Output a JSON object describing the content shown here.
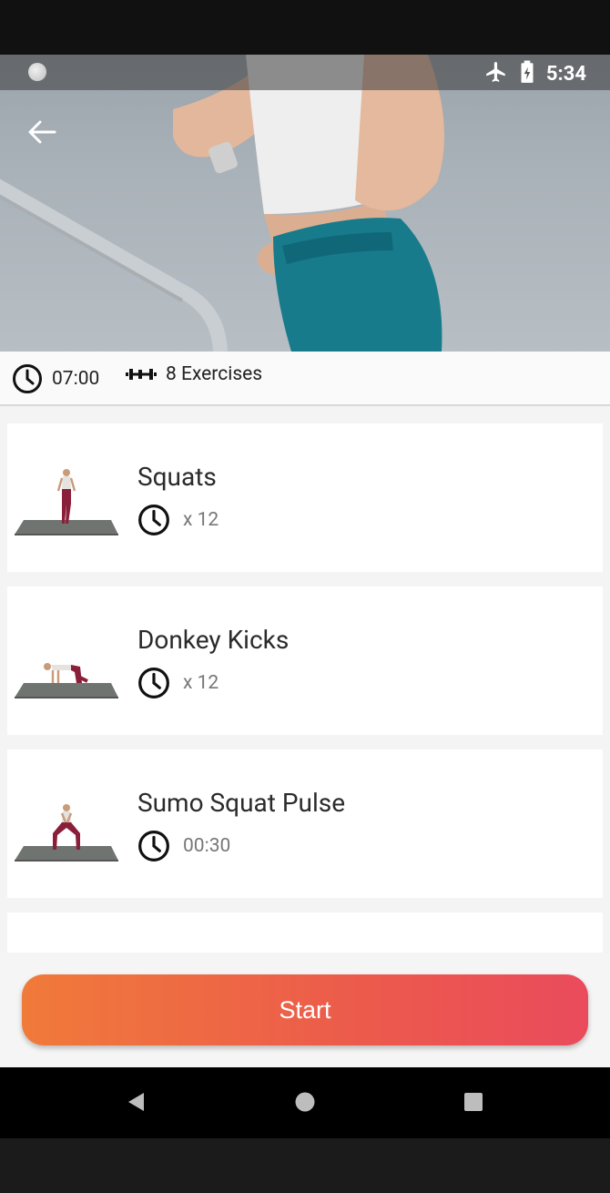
{
  "status_bar": {
    "time": "5:34",
    "icons": [
      "airplane-mode-icon",
      "battery-icon"
    ]
  },
  "hero": {
    "back_icon": "arrow-left-icon"
  },
  "summary": {
    "duration": "07:00",
    "exercises": "8 Exercises"
  },
  "exercises": [
    {
      "name": "Squats",
      "detail": "x 12"
    },
    {
      "name": "Donkey Kicks",
      "detail": "x 12"
    },
    {
      "name": "Sumo Squat Pulse",
      "detail": "00:30"
    }
  ],
  "start": {
    "label": "Start"
  },
  "colors": {
    "accent_start": "#f07a3a",
    "accent_end": "#ea4b5c"
  },
  "nav": {
    "icons": [
      "back-triangle-icon",
      "home-circle-icon",
      "recents-square-icon"
    ]
  }
}
